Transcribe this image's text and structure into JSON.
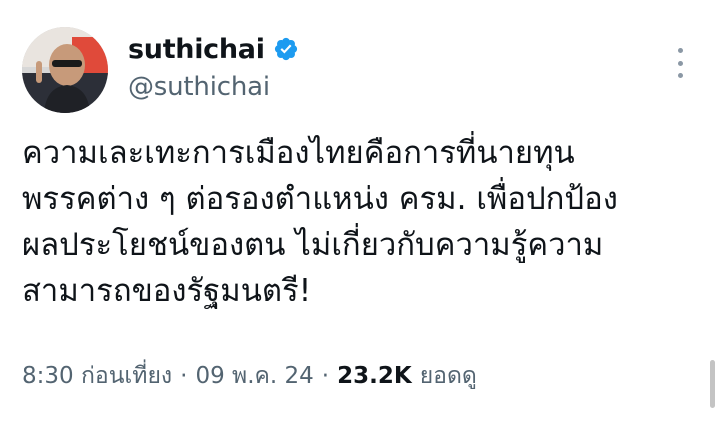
{
  "tweet": {
    "author": {
      "display_name": "suthichai",
      "handle": "@suthichai",
      "verified": true,
      "avatar_icon": "profile-photo"
    },
    "more_icon": "more-vertical-icon",
    "verified_icon": "verified-badge-icon",
    "verified_color": "#1d9bf0",
    "text_lines": [
      "ความเละเทะการเมืองไทยคือการที่นายทุน",
      "พรรคต่าง ๆ ต่อรองตำแหน่ง ครม. เพื่อปกป้อง",
      "ผลประโยชน์ของตน ไม่เกี่ยวกับความรู้ความ",
      "สามารถของรัฐมนตรี!"
    ],
    "meta": {
      "time": "8:30 ก่อนเที่ยง",
      "separator": "·",
      "date": "09 พ.ค. 24",
      "views_count": "23.2K",
      "views_label": "ยอดดู"
    }
  }
}
